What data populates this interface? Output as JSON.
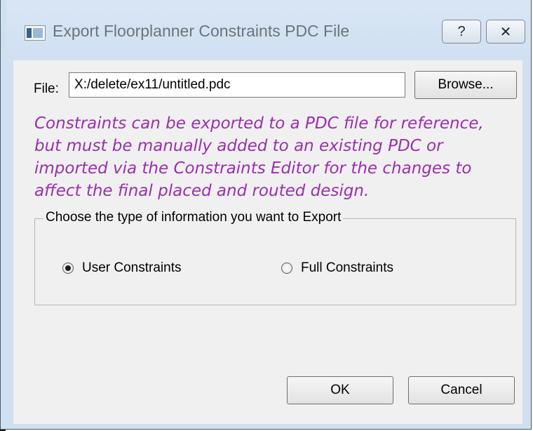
{
  "window": {
    "title": "Export Floorplanner Constraints PDC File",
    "help_glyph": "?",
    "close_glyph": "✕"
  },
  "file": {
    "label": "File:",
    "value": "X:/delete/ex11/untitled.pdc",
    "browse_label": "Browse..."
  },
  "note": "Constraints can be exported to a PDC file for reference, but must be manually added to an existing PDC or imported via the Constraints Editor for the changes to affect the final placed and routed design.",
  "export_type": {
    "legend": "Choose the type of information you want to Export",
    "options": [
      {
        "label": "User Constraints",
        "checked": true
      },
      {
        "label": "Full Constraints",
        "checked": false
      }
    ]
  },
  "buttons": {
    "ok": "OK",
    "cancel": "Cancel"
  },
  "colors": {
    "note_text": "#9b2fae",
    "title_text": "#6c737b"
  }
}
